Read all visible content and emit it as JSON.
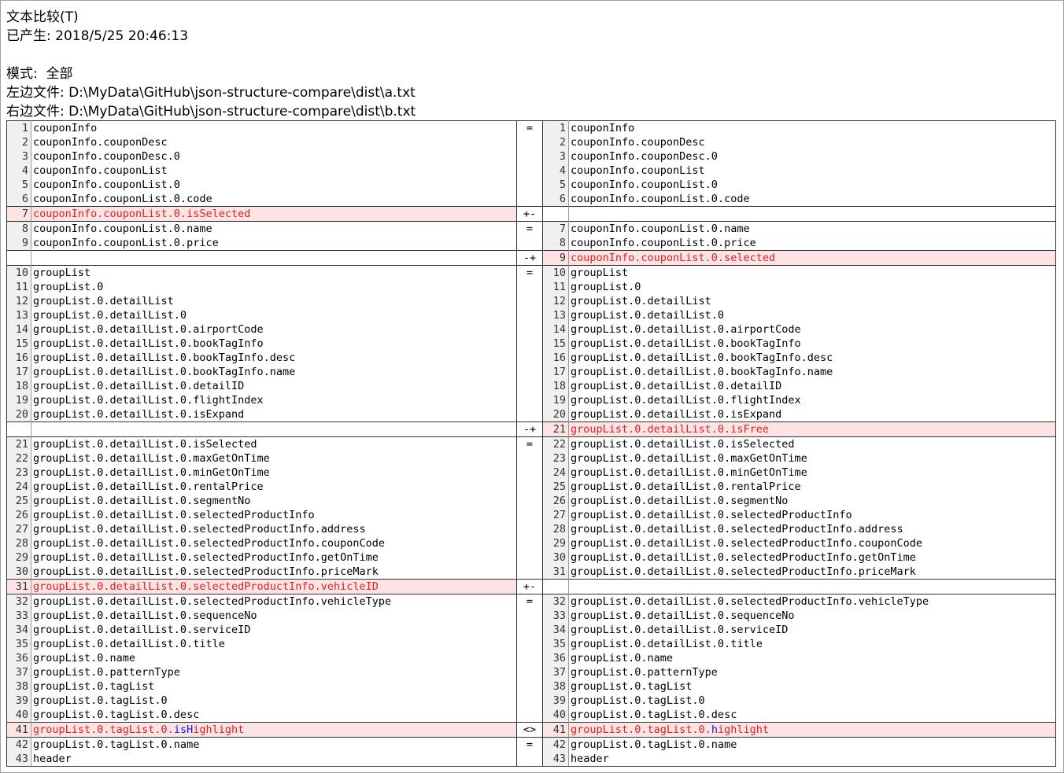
{
  "header": {
    "title": "文本比较(T)",
    "generated": "已产生: 2018/5/25 20:46:13",
    "mode": "模式:  全部",
    "left_file": "左边文件: D:\\MyData\\GitHub\\json-structure-compare\\dist\\a.txt",
    "right_file": "右边文件: D:\\MyData\\GitHub\\json-structure-compare\\dist\\b.txt"
  },
  "colors": {
    "diff_bg": "#fce4e4",
    "diff_text": "#e02020",
    "highlight_text": "#1818d0",
    "gutter_bg": "#f0f0f0"
  },
  "groups": [
    {
      "op": "=",
      "diff": false,
      "rows": [
        [
          "1",
          "couponInfo",
          "1",
          "couponInfo"
        ],
        [
          "2",
          "couponInfo.couponDesc",
          "2",
          "couponInfo.couponDesc"
        ],
        [
          "3",
          "couponInfo.couponDesc.0",
          "3",
          "couponInfo.couponDesc.0"
        ],
        [
          "4",
          "couponInfo.couponList",
          "4",
          "couponInfo.couponList"
        ],
        [
          "5",
          "couponInfo.couponList.0",
          "5",
          "couponInfo.couponList.0"
        ],
        [
          "6",
          "couponInfo.couponList.0.code",
          "6",
          "couponInfo.couponList.0.code"
        ]
      ]
    },
    {
      "op": "+-",
      "diff": true,
      "rows": [
        [
          "7",
          "couponInfo.couponList.0.isSelected",
          "",
          ""
        ]
      ]
    },
    {
      "op": "=",
      "diff": false,
      "rows": [
        [
          "8",
          "couponInfo.couponList.0.name",
          "7",
          "couponInfo.couponList.0.name"
        ],
        [
          "9",
          "couponInfo.couponList.0.price",
          "8",
          "couponInfo.couponList.0.price"
        ]
      ]
    },
    {
      "op": "-+",
      "diff": true,
      "rows": [
        [
          "",
          "",
          "9",
          "couponInfo.couponList.0.selected"
        ]
      ]
    },
    {
      "op": "=",
      "diff": false,
      "rows": [
        [
          "10",
          "groupList",
          "10",
          "groupList"
        ],
        [
          "11",
          "groupList.0",
          "11",
          "groupList.0"
        ],
        [
          "12",
          "groupList.0.detailList",
          "12",
          "groupList.0.detailList"
        ],
        [
          "13",
          "groupList.0.detailList.0",
          "13",
          "groupList.0.detailList.0"
        ],
        [
          "14",
          "groupList.0.detailList.0.airportCode",
          "14",
          "groupList.0.detailList.0.airportCode"
        ],
        [
          "15",
          "groupList.0.detailList.0.bookTagInfo",
          "15",
          "groupList.0.detailList.0.bookTagInfo"
        ],
        [
          "16",
          "groupList.0.detailList.0.bookTagInfo.desc",
          "16",
          "groupList.0.detailList.0.bookTagInfo.desc"
        ],
        [
          "17",
          "groupList.0.detailList.0.bookTagInfo.name",
          "17",
          "groupList.0.detailList.0.bookTagInfo.name"
        ],
        [
          "18",
          "groupList.0.detailList.0.detailID",
          "18",
          "groupList.0.detailList.0.detailID"
        ],
        [
          "19",
          "groupList.0.detailList.0.flightIndex",
          "19",
          "groupList.0.detailList.0.flightIndex"
        ],
        [
          "20",
          "groupList.0.detailList.0.isExpand",
          "20",
          "groupList.0.detailList.0.isExpand"
        ]
      ]
    },
    {
      "op": "-+",
      "diff": true,
      "rows": [
        [
          "",
          "",
          "21",
          "groupList.0.detailList.0.isFree"
        ]
      ]
    },
    {
      "op": "=",
      "diff": false,
      "rows": [
        [
          "21",
          "groupList.0.detailList.0.isSelected",
          "22",
          "groupList.0.detailList.0.isSelected"
        ],
        [
          "22",
          "groupList.0.detailList.0.maxGetOnTime",
          "23",
          "groupList.0.detailList.0.maxGetOnTime"
        ],
        [
          "23",
          "groupList.0.detailList.0.minGetOnTime",
          "24",
          "groupList.0.detailList.0.minGetOnTime"
        ],
        [
          "24",
          "groupList.0.detailList.0.rentalPrice",
          "25",
          "groupList.0.detailList.0.rentalPrice"
        ],
        [
          "25",
          "groupList.0.detailList.0.segmentNo",
          "26",
          "groupList.0.detailList.0.segmentNo"
        ],
        [
          "26",
          "groupList.0.detailList.0.selectedProductInfo",
          "27",
          "groupList.0.detailList.0.selectedProductInfo"
        ],
        [
          "27",
          "groupList.0.detailList.0.selectedProductInfo.address",
          "28",
          "groupList.0.detailList.0.selectedProductInfo.address"
        ],
        [
          "28",
          "groupList.0.detailList.0.selectedProductInfo.couponCode",
          "29",
          "groupList.0.detailList.0.selectedProductInfo.couponCode"
        ],
        [
          "29",
          "groupList.0.detailList.0.selectedProductInfo.getOnTime",
          "30",
          "groupList.0.detailList.0.selectedProductInfo.getOnTime"
        ],
        [
          "30",
          "groupList.0.detailList.0.selectedProductInfo.priceMark",
          "31",
          "groupList.0.detailList.0.selectedProductInfo.priceMark"
        ]
      ]
    },
    {
      "op": "+-",
      "diff": true,
      "rows": [
        [
          "31",
          "groupList.0.detailList.0.selectedProductInfo.vehicleID",
          "",
          ""
        ]
      ]
    },
    {
      "op": "=",
      "diff": false,
      "rows": [
        [
          "32",
          "groupList.0.detailList.0.selectedProductInfo.vehicleType",
          "32",
          "groupList.0.detailList.0.selectedProductInfo.vehicleType"
        ],
        [
          "33",
          "groupList.0.detailList.0.sequenceNo",
          "33",
          "groupList.0.detailList.0.sequenceNo"
        ],
        [
          "34",
          "groupList.0.detailList.0.serviceID",
          "34",
          "groupList.0.detailList.0.serviceID"
        ],
        [
          "35",
          "groupList.0.detailList.0.title",
          "35",
          "groupList.0.detailList.0.title"
        ],
        [
          "36",
          "groupList.0.name",
          "36",
          "groupList.0.name"
        ],
        [
          "37",
          "groupList.0.patternType",
          "37",
          "groupList.0.patternType"
        ],
        [
          "38",
          "groupList.0.tagList",
          "38",
          "groupList.0.tagList"
        ],
        [
          "39",
          "groupList.0.tagList.0",
          "39",
          "groupList.0.tagList.0"
        ],
        [
          "40",
          "groupList.0.tagList.0.desc",
          "40",
          "groupList.0.tagList.0.desc"
        ]
      ]
    },
    {
      "op": "<>",
      "diff": true,
      "changed": true,
      "rows": [
        [
          "41",
          "groupList.0.tagList.0.isHighlight",
          "41",
          "groupList.0.tagList.0.highlight"
        ]
      ]
    },
    {
      "op": "=",
      "diff": false,
      "rows": [
        [
          "42",
          "groupList.0.tagList.0.name",
          "42",
          "groupList.0.tagList.0.name"
        ],
        [
          "43",
          "header",
          "43",
          "header"
        ]
      ]
    }
  ]
}
